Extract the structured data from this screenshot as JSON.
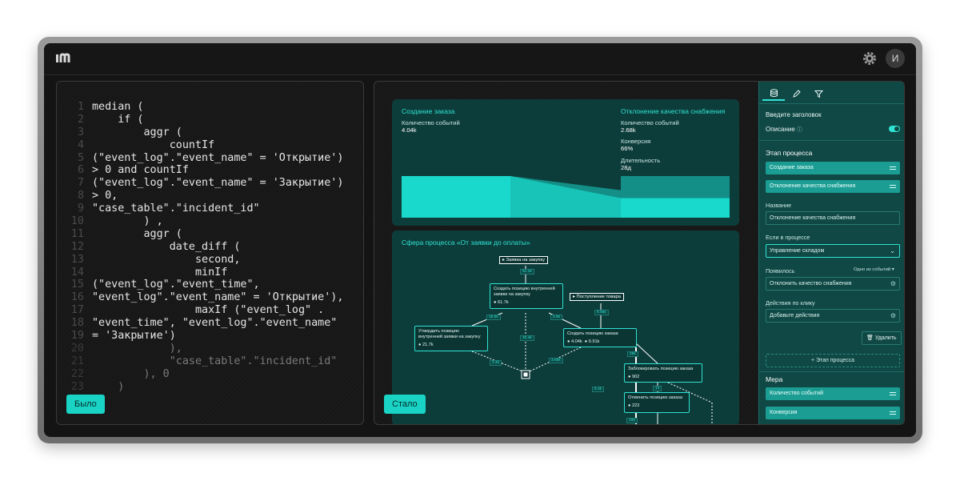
{
  "header": {
    "logo": "logo-mark",
    "avatar_initial": "И",
    "settings_icon": "gear-icon"
  },
  "colors": {
    "accent": "#19d3c5",
    "card": "#0d3d3b",
    "sidebar": "#0f4845"
  },
  "before": {
    "button_label": "Было",
    "code": [
      {
        "n": "1",
        "t": "median ("
      },
      {
        "n": "2",
        "t": "    if ("
      },
      {
        "n": "3",
        "t": "        aggr ("
      },
      {
        "n": "4",
        "t": "            countIf"
      },
      {
        "n": "5",
        "t": "(\"event_log\".\"event_name\" = 'Открытие')"
      },
      {
        "n": "6",
        "t": "> 0 and countIf"
      },
      {
        "n": "7",
        "t": "(\"event_log\".\"event_name\" = 'Закрытие')"
      },
      {
        "n": "8",
        "t": "> 0,"
      },
      {
        "n": "9",
        "t": "\"case_table\".\"incident_id\""
      },
      {
        "n": "10",
        "t": "        ) ,"
      },
      {
        "n": "11",
        "t": "        aggr ("
      },
      {
        "n": "12",
        "t": "            date_diff ("
      },
      {
        "n": "13",
        "t": "                second,"
      },
      {
        "n": "14",
        "t": "                minIf"
      },
      {
        "n": "15",
        "t": "(\"event_log\".\"event_time\","
      },
      {
        "n": "16",
        "t": "\"event_log\".\"event_name\" = 'Открытие'),"
      },
      {
        "n": "17",
        "t": "                maxIf (\"event_log\" ."
      },
      {
        "n": "18",
        "t": "\"event_time\", \"event_log\".\"event_name\""
      },
      {
        "n": "19",
        "t": "= 'Закрытие')"
      },
      {
        "n": "20",
        "t": "            ),"
      },
      {
        "n": "21",
        "t": "            \"case_table\".\"incident_id\""
      },
      {
        "n": "22",
        "t": "        ), 0"
      },
      {
        "n": "23",
        "t": "    )"
      }
    ]
  },
  "after": {
    "button_label": "Стало",
    "funnel": {
      "left_title": "Создание заказа",
      "left_metric_label": "Количество событий",
      "left_metric_value": "4.04k",
      "right_title": "Отклонение качества снабжения",
      "right_metric_label": "Количество событий",
      "right_metric_value": "2.68k",
      "conversion_label": "Конверсия",
      "conversion_value": "66%",
      "duration_label": "Длительность",
      "duration_value": "28д",
      "conversion_fraction": 0.66
    },
    "process": {
      "title": "Сфера процесса «От заявки до оплаты»",
      "events": {
        "request": "Заявка на закупку",
        "arrival": "Поступление товара"
      },
      "nodes": {
        "create_position_l1": "Создать позицию внутренней",
        "create_position_l2": "заявки на закупку",
        "create_position_metric": "61.7k",
        "approve_l1": "Утвердить позицию",
        "approve_l2": "внутренней заявки на закупку",
        "approve_metric": "21.7k",
        "create_order": "Создать позицию заказа",
        "create_order_metric1": "4.04k",
        "create_order_metric2": "9.91k",
        "block": "Заблокировать позицию заказа",
        "block_metric": "902",
        "cancel": "Отменить позицию заказа",
        "cancel_metric": "223"
      },
      "tags": {
        "t1": "61.1k",
        "t2": "5.65k",
        "t3": "19.5k",
        "t4": "2.5k",
        "t5": "32.4k",
        "t6": "2.4k",
        "t7": "3.65k",
        "t8": "25k",
        "t9": "5.1k",
        "t10": "14",
        "t11": "106"
      }
    },
    "sidebar": {
      "tabs": [
        "database-icon",
        "pen-icon",
        "filter-icon"
      ],
      "title_placeholder": "Введите заголовок",
      "description_label": "Описание",
      "stage_heading": "Этап процесса",
      "stages": [
        "Создание заказа",
        "Отклонение качества снабжения"
      ],
      "name_label": "Название",
      "name_value": "Отклонение качества снабжения",
      "if_in_process_label": "Если в процессе",
      "if_in_process_value": "Управление складом",
      "appeared_label": "Появилось",
      "appeared_mode": "Одно из событий",
      "appeared_value": "Отклонить качество снабжения",
      "click_actions_label": "Действия по клику",
      "click_actions_value": "Добавьте действия",
      "delete_label": "Удалить",
      "add_stage_label": "+ Этап процесса",
      "measure_heading": "Мера",
      "measures": [
        "Количество событий",
        "Конверсия"
      ]
    }
  }
}
